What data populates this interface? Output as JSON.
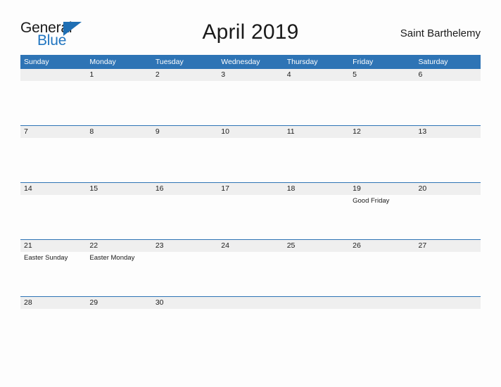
{
  "brand": {
    "word_one": "General",
    "word_two": "Blue",
    "flag_icon": "blue-triangle-flag-icon",
    "accent_color": "#2e74b5",
    "text_color": "#1a1a1a"
  },
  "header": {
    "title": "April 2019",
    "location": "Saint Barthelemy"
  },
  "calendar": {
    "weekday_headers": [
      "Sunday",
      "Monday",
      "Tuesday",
      "Wednesday",
      "Thursday",
      "Friday",
      "Saturday"
    ],
    "weeks": [
      [
        {
          "day": "",
          "events": []
        },
        {
          "day": "1",
          "events": []
        },
        {
          "day": "2",
          "events": []
        },
        {
          "day": "3",
          "events": []
        },
        {
          "day": "4",
          "events": []
        },
        {
          "day": "5",
          "events": []
        },
        {
          "day": "6",
          "events": []
        }
      ],
      [
        {
          "day": "7",
          "events": []
        },
        {
          "day": "8",
          "events": []
        },
        {
          "day": "9",
          "events": []
        },
        {
          "day": "10",
          "events": []
        },
        {
          "day": "11",
          "events": []
        },
        {
          "day": "12",
          "events": []
        },
        {
          "day": "13",
          "events": []
        }
      ],
      [
        {
          "day": "14",
          "events": []
        },
        {
          "day": "15",
          "events": []
        },
        {
          "day": "16",
          "events": []
        },
        {
          "day": "17",
          "events": []
        },
        {
          "day": "18",
          "events": []
        },
        {
          "day": "19",
          "events": [
            "Good Friday"
          ]
        },
        {
          "day": "20",
          "events": []
        }
      ],
      [
        {
          "day": "21",
          "events": [
            "Easter Sunday"
          ]
        },
        {
          "day": "22",
          "events": [
            "Easter Monday"
          ]
        },
        {
          "day": "23",
          "events": []
        },
        {
          "day": "24",
          "events": []
        },
        {
          "day": "25",
          "events": []
        },
        {
          "day": "26",
          "events": []
        },
        {
          "day": "27",
          "events": []
        }
      ],
      [
        {
          "day": "28",
          "events": []
        },
        {
          "day": "29",
          "events": []
        },
        {
          "day": "30",
          "events": []
        },
        {
          "day": "",
          "events": []
        },
        {
          "day": "",
          "events": []
        },
        {
          "day": "",
          "events": []
        },
        {
          "day": "",
          "events": []
        }
      ]
    ]
  }
}
